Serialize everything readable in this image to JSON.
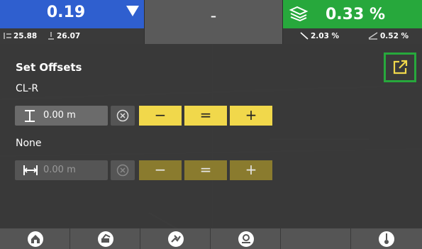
{
  "top_bar": {
    "blue_tile": {
      "value": "0.19",
      "stat1": "25.88",
      "stat2": "26.07"
    },
    "middle_tile": {
      "value": "-"
    },
    "green_tile": {
      "value": "0.33 %",
      "stat1": "2.03 %",
      "stat2": "0.52 %"
    }
  },
  "panel": {
    "title": "Set Offsets",
    "sections": [
      {
        "label": "CL-R",
        "field_value": "0.00 m",
        "enabled": true
      },
      {
        "label": "None",
        "field_value": "0.00 m",
        "enabled": false
      }
    ],
    "button_labels": {
      "minus": "−",
      "equals": "=",
      "plus": "+"
    }
  },
  "bottom_nav": {
    "items": [
      "home-icon",
      "machine-icon",
      "survey-icon",
      "location-icon",
      "plumb-icon"
    ]
  },
  "colors": {
    "blue": "#2f5fcf",
    "green": "#27a83c",
    "yellow": "#f1d84b",
    "yellow_dim": "#8a7b2e"
  }
}
